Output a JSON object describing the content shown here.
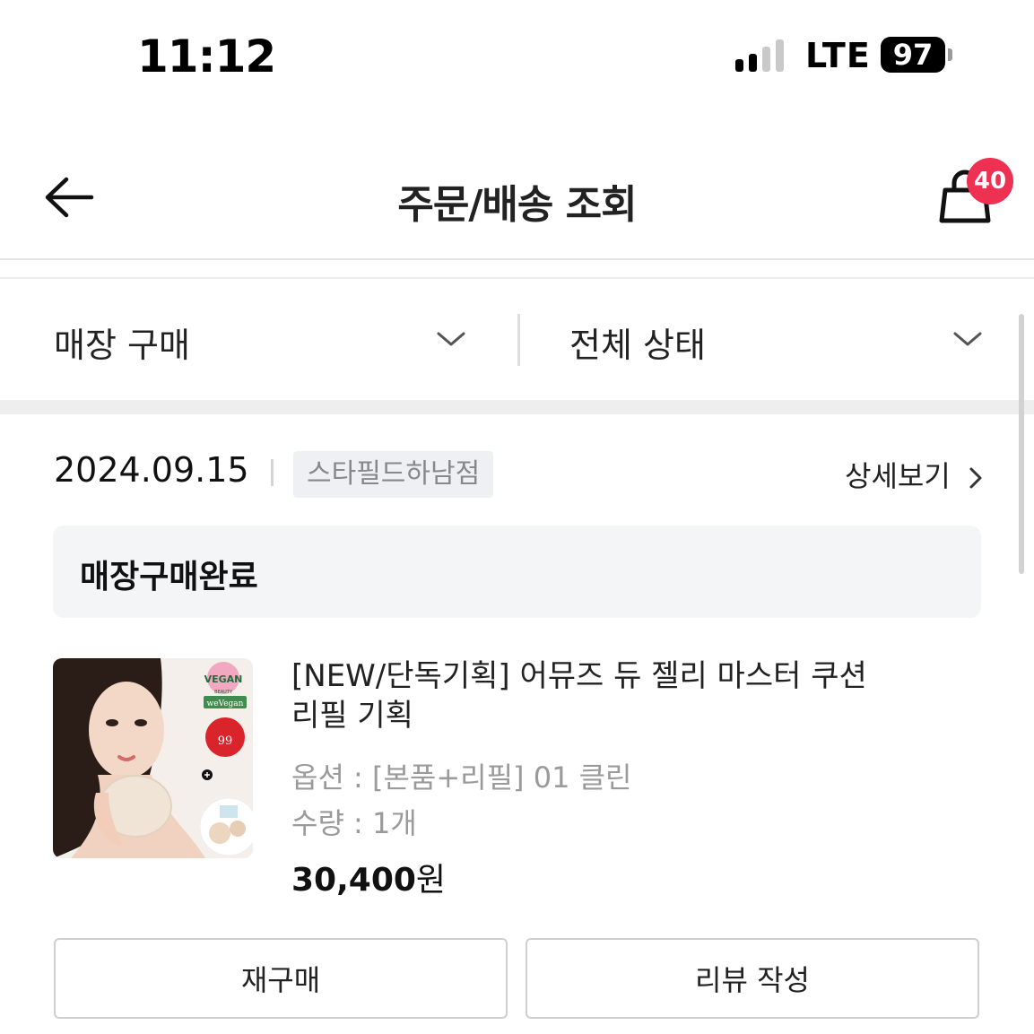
{
  "status_bar": {
    "time": "11:12",
    "network": "LTE",
    "battery": "97"
  },
  "header": {
    "title": "주문/배송 조회",
    "back_icon": "arrow-left-icon",
    "cart_icon": "shopping-bag-icon",
    "cart_count": "40"
  },
  "filters": {
    "purchase_type": "매장 구매",
    "status": "전체 상태",
    "dropdown_icon": "chevron-down-icon"
  },
  "order": {
    "date": "2024.09.15",
    "store": "스타필드하남점",
    "detail_label": "상세보기",
    "detail_icon": "chevron-right-icon",
    "status": "매장구매완료",
    "product": {
      "image_icon": "product-photo",
      "image_badges": {
        "vegan": "VEGAN",
        "vegan_sub": "BEAUTY",
        "wevegan": "weVegan",
        "number": "99"
      },
      "name": "[NEW/단독기획] 어뮤즈 듀 젤리 마스터 쿠션 리필 기획",
      "option": "옵션 : [본품+리필] 01 클린",
      "quantity": "수량 : 1개",
      "price": "30,400",
      "currency": "원"
    },
    "actions": {
      "rebuy": "재구매",
      "review": "리뷰 작성"
    }
  },
  "colors": {
    "badge": "#ee3152",
    "status_box": "#f4f5f7",
    "store_tag": "#eef0f3"
  }
}
